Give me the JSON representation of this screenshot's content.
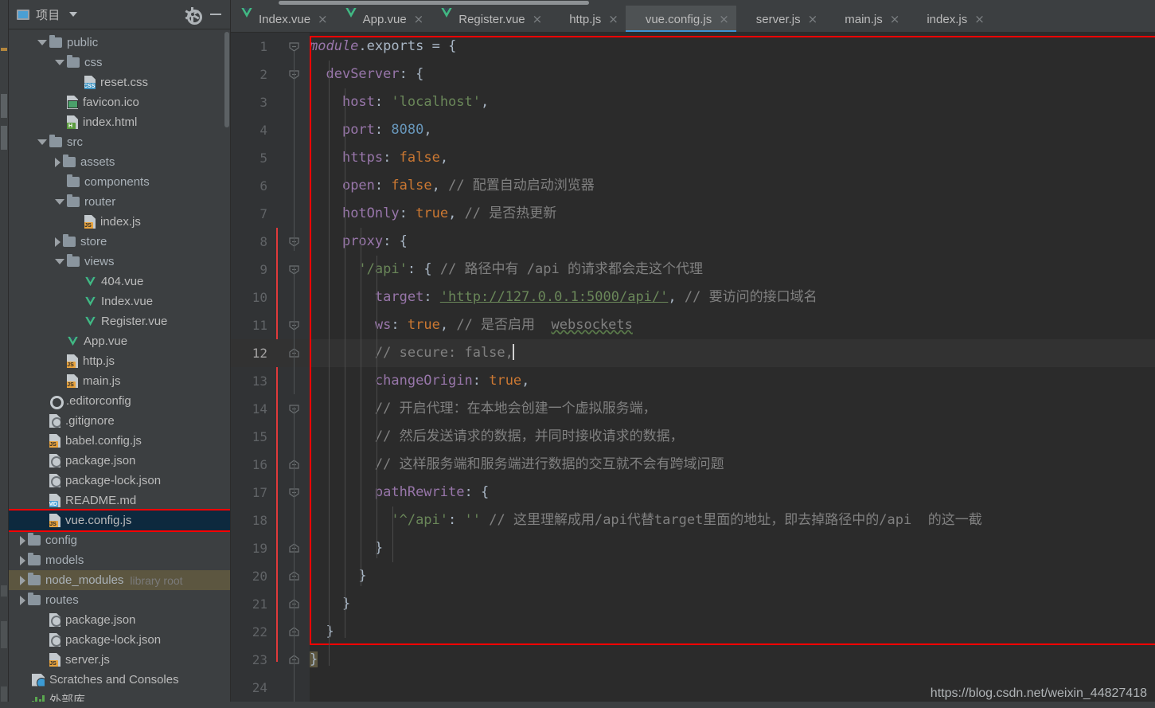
{
  "window": {
    "project_panel_title": "项目",
    "gear_icon": "gear-icon",
    "minimize_icon": "minimize-icon",
    "caret_icon": "chevron-down-icon"
  },
  "tree": [
    {
      "label": "public",
      "type": "folder",
      "arrow": "down",
      "indent": 1,
      "state": "expanded"
    },
    {
      "label": "css",
      "type": "folder",
      "arrow": "down",
      "indent": 2,
      "state": "expanded"
    },
    {
      "label": "reset.css",
      "type": "css",
      "arrow": "none",
      "indent": 3,
      "badge": "CSS"
    },
    {
      "label": "favicon.ico",
      "type": "image",
      "arrow": "none",
      "indent": 2
    },
    {
      "label": "index.html",
      "type": "html",
      "arrow": "none",
      "indent": 2,
      "badge": "H"
    },
    {
      "label": "src",
      "type": "folder",
      "arrow": "down",
      "indent": 1,
      "state": "expanded"
    },
    {
      "label": "assets",
      "type": "folder",
      "arrow": "right",
      "indent": 2,
      "state": "collapsed"
    },
    {
      "label": "components",
      "type": "folder",
      "arrow": "none",
      "indent": 2
    },
    {
      "label": "router",
      "type": "folder",
      "arrow": "down",
      "indent": 2,
      "state": "expanded"
    },
    {
      "label": "index.js",
      "type": "js",
      "arrow": "none",
      "indent": 3,
      "badge": "JS"
    },
    {
      "label": "store",
      "type": "folder",
      "arrow": "right",
      "indent": 2,
      "state": "collapsed"
    },
    {
      "label": "views",
      "type": "folder",
      "arrow": "down",
      "indent": 2,
      "state": "expanded"
    },
    {
      "label": "404.vue",
      "type": "vue",
      "arrow": "none",
      "indent": 3
    },
    {
      "label": "Index.vue",
      "type": "vue",
      "arrow": "none",
      "indent": 3
    },
    {
      "label": "Register.vue",
      "type": "vue",
      "arrow": "none",
      "indent": 3
    },
    {
      "label": "App.vue",
      "type": "vue",
      "arrow": "none",
      "indent": 2
    },
    {
      "label": "http.js",
      "type": "js",
      "arrow": "none",
      "indent": 2,
      "badge": "JS"
    },
    {
      "label": "main.js",
      "type": "js",
      "arrow": "none",
      "indent": 2,
      "badge": "JS"
    },
    {
      "label": ".editorconfig",
      "type": "config",
      "arrow": "none",
      "indent": 1
    },
    {
      "label": ".gitignore",
      "type": "git",
      "arrow": "none",
      "indent": 1
    },
    {
      "label": "babel.config.js",
      "type": "js",
      "arrow": "none",
      "indent": 1,
      "badge": "JS"
    },
    {
      "label": "package.json",
      "type": "json",
      "arrow": "none",
      "indent": 1
    },
    {
      "label": "package-lock.json",
      "type": "json",
      "arrow": "none",
      "indent": 1
    },
    {
      "label": "README.md",
      "type": "md",
      "arrow": "none",
      "indent": 1,
      "badge": "MD"
    },
    {
      "label": "vue.config.js",
      "type": "js",
      "arrow": "none",
      "indent": 1,
      "badge": "JS",
      "selected": true
    },
    {
      "label": "config",
      "type": "folder",
      "arrow": "right",
      "indent": 0,
      "state": "collapsed"
    },
    {
      "label": "models",
      "type": "folder",
      "arrow": "right",
      "indent": 0,
      "state": "collapsed"
    },
    {
      "label": "node_modules",
      "type": "folder",
      "arrow": "right",
      "indent": 0,
      "state": "collapsed",
      "sub": "library root",
      "highlighted": true
    },
    {
      "label": "routes",
      "type": "folder",
      "arrow": "right",
      "indent": 0,
      "state": "collapsed"
    },
    {
      "label": "package.json",
      "type": "json",
      "arrow": "none",
      "indent": 1
    },
    {
      "label": "package-lock.json",
      "type": "json",
      "arrow": "none",
      "indent": 1
    },
    {
      "label": "server.js",
      "type": "js",
      "arrow": "none",
      "indent": 1,
      "badge": "JS"
    },
    {
      "label": "Scratches and Consoles",
      "type": "scratch",
      "arrow": "none",
      "indent": 0
    },
    {
      "label": "外部库",
      "type": "library",
      "arrow": "none",
      "indent": 0
    }
  ],
  "tabs": [
    {
      "label": "Index.vue",
      "icon": "vue-file-icon",
      "active": false,
      "close": "×"
    },
    {
      "label": "App.vue",
      "icon": "vue-file-icon",
      "active": false,
      "close": "×"
    },
    {
      "label": "Register.vue",
      "icon": "vue-file-icon",
      "active": false,
      "close": "×"
    },
    {
      "label": "http.js",
      "icon": "js-file-icon",
      "active": false,
      "close": "×"
    },
    {
      "label": "vue.config.js",
      "icon": "js-file-icon",
      "active": true,
      "close": "×"
    },
    {
      "label": "server.js",
      "icon": "js-file-icon",
      "active": false,
      "close": "×"
    },
    {
      "label": "main.js",
      "icon": "js-file-icon",
      "active": false,
      "close": "×"
    },
    {
      "label": "index.js",
      "icon": "js-file-icon",
      "active": false,
      "close": "×"
    }
  ],
  "editor": {
    "line_count": 24,
    "cursor_line": 12,
    "lines": [
      {
        "n": 1,
        "text": "module.exports = {"
      },
      {
        "n": 2,
        "text": "  devServer: {"
      },
      {
        "n": 3,
        "text": "    host: 'localhost',"
      },
      {
        "n": 4,
        "text": "    port: 8080,"
      },
      {
        "n": 5,
        "text": "    https: false,"
      },
      {
        "n": 6,
        "text": "    open: false, // 配置自动启动浏览器"
      },
      {
        "n": 7,
        "text": "    hotOnly: true, // 是否热更新"
      },
      {
        "n": 8,
        "text": "    proxy: {"
      },
      {
        "n": 9,
        "text": "      '/api': { // 路径中有 /api 的请求都会走这个代理"
      },
      {
        "n": 10,
        "text": "        target: 'http://127.0.0.1:5000/api/', // 要访问的接口域名"
      },
      {
        "n": 11,
        "text": "        ws: true, // 是否启用  websockets"
      },
      {
        "n": 12,
        "text": "        // secure: false,"
      },
      {
        "n": 13,
        "text": "        changeOrigin: true,"
      },
      {
        "n": 14,
        "text": "        // 开启代理：在本地会创建一个虚拟服务端，"
      },
      {
        "n": 15,
        "text": "        // 然后发送请求的数据，并同时接收请求的数据，"
      },
      {
        "n": 16,
        "text": "        // 这样服务端和服务端进行数据的交互就不会有跨域问题"
      },
      {
        "n": 17,
        "text": "        pathRewrite: {"
      },
      {
        "n": 18,
        "text": "          '^/api': '' // 这里理解成用/api代替target里面的地址，即去掉路径中的/api  的这一截"
      },
      {
        "n": 19,
        "text": "        }"
      },
      {
        "n": 20,
        "text": "      }"
      },
      {
        "n": 21,
        "text": "    }"
      },
      {
        "n": 22,
        "text": "  }"
      },
      {
        "n": 23,
        "text": "}"
      },
      {
        "n": 24,
        "text": ""
      }
    ],
    "intention_bulb_icon": "lightbulb-icon",
    "intention_bulb_line": 12
  },
  "watermark": "https://blog.csdn.net/weixin_44827418",
  "colors": {
    "panel_bg": "#3c3f41",
    "editor_bg": "#2b2b2b",
    "gutter_bg": "#313335",
    "accent_tab": "#3d92d4",
    "annotation_red": "#ff0000",
    "selection_blue": "#0d293e",
    "keyword_orange": "#cc7832",
    "property_purple": "#9876aa",
    "string_green": "#6a8759",
    "number_blue": "#6897bb",
    "comment_gray": "#808080",
    "text_default": "#a9b7c6",
    "vue_green": "#41b883",
    "js_yellow": "#e8a33d"
  }
}
